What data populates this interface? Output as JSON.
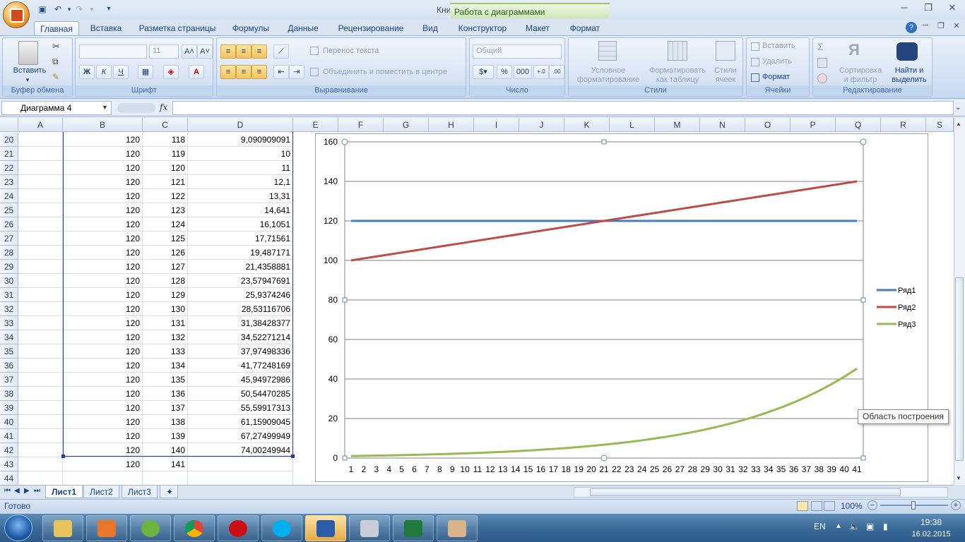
{
  "window": {
    "title": "Книга1 - Microsoft Excel",
    "context_tab_title": "Работа с диаграммами"
  },
  "ribbon_tabs": [
    "Главная",
    "Вставка",
    "Разметка страницы",
    "Формулы",
    "Данные",
    "Рецензирование",
    "Вид",
    "Конструктор",
    "Макет",
    "Формат"
  ],
  "ribbon": {
    "clipboard": {
      "paste": "Вставить",
      "group": "Буфер обмена"
    },
    "font": {
      "group": "Шрифт",
      "size": "11",
      "bold": "Ж",
      "italic": "К",
      "underline": "Ч"
    },
    "alignment": {
      "wrap": "Перенос текста",
      "merge": "Объединить и поместить в центре",
      "group": "Выравнивание"
    },
    "number": {
      "format": "Общий",
      "group": "Число",
      "percent": "%",
      "thousands": "000"
    },
    "styles": {
      "conditional_1": "Условное",
      "conditional_2": "форматирование",
      "astable_1": "Форматировать",
      "astable_2": "как таблицу",
      "cellstyles_1": "Стили",
      "cellstyles_2": "ячеек",
      "group": "Стили"
    },
    "cells": {
      "insert": "Вставить",
      "delete": "Удалить",
      "format": "Формат",
      "group": "Ячейки"
    },
    "editing": {
      "sort_1": "Сортировка",
      "sort_2": "и фильтр",
      "find_1": "Найти и",
      "find_2": "выделить",
      "group": "Редактирование",
      "sigma": "Σ"
    }
  },
  "formula_bar": {
    "name_box": "Диаграмма 4",
    "fx": "fx",
    "value": ""
  },
  "columns": [
    "A",
    "B",
    "C",
    "D",
    "E",
    "F",
    "G",
    "H",
    "I",
    "J",
    "K",
    "L",
    "M",
    "N",
    "O",
    "P",
    "Q",
    "R",
    "S"
  ],
  "rows": [
    {
      "n": "20",
      "b": "120",
      "c": "118",
      "d": "9,090909091"
    },
    {
      "n": "21",
      "b": "120",
      "c": "119",
      "d": "10"
    },
    {
      "n": "22",
      "b": "120",
      "c": "120",
      "d": "11"
    },
    {
      "n": "23",
      "b": "120",
      "c": "121",
      "d": "12,1"
    },
    {
      "n": "24",
      "b": "120",
      "c": "122",
      "d": "13,31"
    },
    {
      "n": "25",
      "b": "120",
      "c": "123",
      "d": "14,641"
    },
    {
      "n": "26",
      "b": "120",
      "c": "124",
      "d": "16,1051"
    },
    {
      "n": "27",
      "b": "120",
      "c": "125",
      "d": "17,71561"
    },
    {
      "n": "28",
      "b": "120",
      "c": "126",
      "d": "19,487171"
    },
    {
      "n": "29",
      "b": "120",
      "c": "127",
      "d": "21,4358881"
    },
    {
      "n": "30",
      "b": "120",
      "c": "128",
      "d": "23,57947691"
    },
    {
      "n": "31",
      "b": "120",
      "c": "129",
      "d": "25,9374246"
    },
    {
      "n": "32",
      "b": "120",
      "c": "130",
      "d": "28,53116706"
    },
    {
      "n": "33",
      "b": "120",
      "c": "131",
      "d": "31,38428377"
    },
    {
      "n": "34",
      "b": "120",
      "c": "132",
      "d": "34,52271214"
    },
    {
      "n": "35",
      "b": "120",
      "c": "133",
      "d": "37,97498336"
    },
    {
      "n": "36",
      "b": "120",
      "c": "134",
      "d": "41,77248169"
    },
    {
      "n": "37",
      "b": "120",
      "c": "135",
      "d": "45,94972986"
    },
    {
      "n": "38",
      "b": "120",
      "c": "136",
      "d": "50,54470285"
    },
    {
      "n": "39",
      "b": "120",
      "c": "137",
      "d": "55,59917313"
    },
    {
      "n": "40",
      "b": "120",
      "c": "138",
      "d": "61,15909045"
    },
    {
      "n": "41",
      "b": "120",
      "c": "139",
      "d": "67,27499949"
    },
    {
      "n": "42",
      "b": "120",
      "c": "140",
      "d": "74,00249944"
    },
    {
      "n": "43",
      "b": "120",
      "c": "141",
      "d": ""
    },
    {
      "n": "44",
      "b": "",
      "c": "",
      "d": ""
    }
  ],
  "chart_data": {
    "type": "line",
    "title": "",
    "xlabel": "",
    "ylabel": "",
    "ylim": [
      0,
      160
    ],
    "yticks": [
      0,
      20,
      40,
      60,
      80,
      100,
      120,
      140,
      160
    ],
    "grid": true,
    "legend_position": "right",
    "x": [
      1,
      2,
      3,
      4,
      5,
      6,
      7,
      8,
      9,
      10,
      11,
      12,
      13,
      14,
      15,
      16,
      17,
      18,
      19,
      20,
      21,
      22,
      23,
      24,
      25,
      26,
      27,
      28,
      29,
      30,
      31,
      32,
      33,
      34,
      35,
      36,
      37,
      38,
      39,
      40,
      41
    ],
    "series": [
      {
        "name": "Ряд1",
        "color": "#4a7ebb",
        "values": [
          120,
          120,
          120,
          120,
          120,
          120,
          120,
          120,
          120,
          120,
          120,
          120,
          120,
          120,
          120,
          120,
          120,
          120,
          120,
          120,
          120,
          120,
          120,
          120,
          120,
          120,
          120,
          120,
          120,
          120,
          120,
          120,
          120,
          120,
          120,
          120,
          120,
          120,
          120,
          120,
          120
        ]
      },
      {
        "name": "Ряд2",
        "color": "#be4b48",
        "values": [
          100,
          101,
          102,
          103,
          104,
          105,
          106,
          107,
          108,
          109,
          110,
          111,
          112,
          113,
          114,
          115,
          116,
          117,
          118,
          119,
          120,
          121,
          122,
          123,
          124,
          125,
          126,
          127,
          128,
          129,
          130,
          131,
          132,
          133,
          134,
          135,
          136,
          137,
          138,
          139,
          140
        ]
      },
      {
        "name": "Ряд3",
        "color": "#98b954",
        "values": [
          1,
          1.1,
          1.21,
          1.33,
          1.46,
          1.61,
          1.77,
          1.95,
          2.14,
          2.36,
          2.59,
          2.85,
          3.14,
          3.45,
          3.8,
          4.18,
          4.59,
          5.05,
          5.56,
          6.12,
          6.73,
          7.4,
          8.14,
          8.95,
          9.85,
          10.83,
          11.92,
          13.11,
          14.42,
          15.86,
          17.45,
          19.19,
          21.11,
          23.23,
          25.55,
          28.1,
          30.91,
          34,
          37.4,
          41.14,
          45.26
        ]
      }
    ],
    "tooltip": "Область построения"
  },
  "sheets": [
    "Лист1",
    "Лист2",
    "Лист3"
  ],
  "status": {
    "ready": "Готово",
    "zoom": "100%"
  },
  "taskbar": {
    "lang": "EN",
    "time": "19:38",
    "date": "16.02.2015"
  }
}
